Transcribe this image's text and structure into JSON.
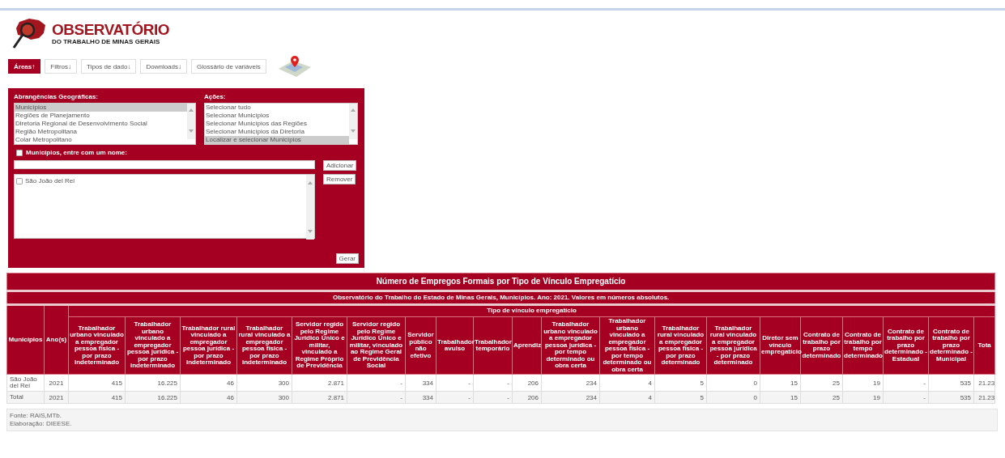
{
  "header": {
    "logo_title": "OBSERVATÓRIO",
    "logo_subtitle": "DO TRABALHO DE MINAS GERAIS"
  },
  "tabs": [
    {
      "label": "Áreas",
      "arrow": "↑",
      "selected": true
    },
    {
      "label": "Filtros",
      "arrow": "↓",
      "selected": false
    },
    {
      "label": "Tipos de dado",
      "arrow": "↓",
      "selected": false
    },
    {
      "label": "Downloads",
      "arrow": "↓",
      "selected": false
    },
    {
      "label": "Glossário de variáveis",
      "selected": false
    }
  ],
  "filter_panel": {
    "geo_label": "Abrangências Geográficas:",
    "geo_options": [
      {
        "label": "Municípios",
        "selected": true
      },
      {
        "label": "Regiões de Planejamento",
        "selected": false
      },
      {
        "label": "Diretoria Regional de Desenvolvimento Social",
        "selected": false
      },
      {
        "label": "Região Metropolitana",
        "selected": false
      },
      {
        "label": "Colar Metropolitano",
        "selected": false
      }
    ],
    "actions_label": "Ações:",
    "action_options": [
      {
        "label": "Selecionar tudo",
        "selected": false
      },
      {
        "label": "Selecionar Municípios",
        "selected": false
      },
      {
        "label": "Selecionar Municípios das Regiões",
        "selected": false
      },
      {
        "label": "Selecionar Municípios da Diretoria",
        "selected": false
      },
      {
        "label": "Localizar e selecionar Municípios",
        "selected": true
      }
    ],
    "name_search": {
      "label": "Municípios, entre com um nome:",
      "checked": false
    },
    "add_button": "Adicionar",
    "chosen": [
      {
        "label": "São João del Rei",
        "checked": false
      }
    ],
    "remove_button": "Remover",
    "generate_button": "Gerar"
  },
  "table": {
    "title": "Número de Empregos Formais por Tipo de Vínculo Empregatício",
    "subtitle": "Observatório do Trabalho do Estado de Minas Gerais, Municípios. Ano: 2021. Valores em números absolutos.",
    "group_header": "Tipo de vínculo empregatício",
    "columns": [
      "Municípios",
      "Ano(s)",
      "Trabalhador urbano vinculado a empregador pessoa física - por prazo indeterminado",
      "Trabalhador urbano vinculado a empregador pessoa jurídica - por prazo indeterminado",
      "Trabalhador rural vinculado a empregador pessoa jurídica - por prazo indeterminado",
      "Trabalhador rural vinculado a empregador pessoa física - por prazo indeterminado",
      "Servidor regido pelo Regime Jurídico Único e militar, vinculado a Regime Próprio de Previdência",
      "Servidor regido pelo Regime Jurídico Único e militar, vinculado ao Regime Geral de Previdência Social",
      "Servidor público não efetivo",
      "Trabalhador avulso",
      "Trabalhador temporário",
      "Aprendiz",
      "Trabalhador urbano vinculado a empregador pessoa jurídica - por tempo determinado ou obra certa",
      "Trabalhador urbano vinculado a empregador pessoa física - por tempo determinado ou obra certa",
      "Trabalhador rural vinculado a empregador pessoa física - por prazo determinado",
      "Trabalhador rural vinculado a empregador pessoa jurídica - por prazo determinado",
      "Diretor sem vínculo empregatício",
      "Contrato de trabalho por prazo determinado",
      "Contrato de trabalho por tempo determinado",
      "Contrato de trabalho por prazo determinado - Estadual",
      "Contrato de trabalho por prazo determinado - Municipal",
      "Tota"
    ],
    "rows": [
      {
        "total": false,
        "cells": [
          "São João del Rei",
          "2021",
          "415",
          "16.225",
          "46",
          "300",
          "2.871",
          "-",
          "334",
          "-",
          "-",
          "206",
          "234",
          "4",
          "5",
          "0",
          "15",
          "25",
          "19",
          "-",
          "535",
          "21.23"
        ]
      },
      {
        "total": true,
        "cells": [
          "Total",
          "2021",
          "415",
          "16.225",
          "46",
          "300",
          "2.871",
          "-",
          "334",
          "-",
          "-",
          "206",
          "234",
          "4",
          "5",
          "0",
          "15",
          "25",
          "19",
          "-",
          "535",
          "21.23"
        ]
      }
    ]
  },
  "footer": {
    "lines": [
      "Fonte: RAIS,MTb.",
      "Elaboração: DIEESE."
    ]
  }
}
